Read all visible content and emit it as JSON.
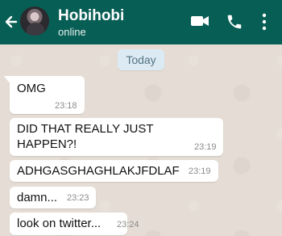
{
  "header": {
    "contact_name": "Hobihobi",
    "status": "online",
    "icons": [
      "back-arrow-icon",
      "video-call-icon",
      "phone-icon",
      "more-vert-icon"
    ],
    "colors": {
      "bar": "#075e54",
      "text": "#ffffff"
    }
  },
  "chat": {
    "date_separator": "Today",
    "messages": [
      {
        "text": "OMG",
        "time": "23:18"
      },
      {
        "text": "DID THAT REALLY JUST HAPPEN?!",
        "time": "23:19"
      },
      {
        "text": "ADHGASGHAGHLAKJFDLAF",
        "time": "23:19"
      },
      {
        "text": "damn...",
        "time": "23:23"
      },
      {
        "text": "look on twitter...",
        "time": "23:24"
      }
    ],
    "colors": {
      "wallpaper": "#e5ddd5",
      "bubble": "#ffffff",
      "date_pill": "#dcebf3"
    }
  }
}
